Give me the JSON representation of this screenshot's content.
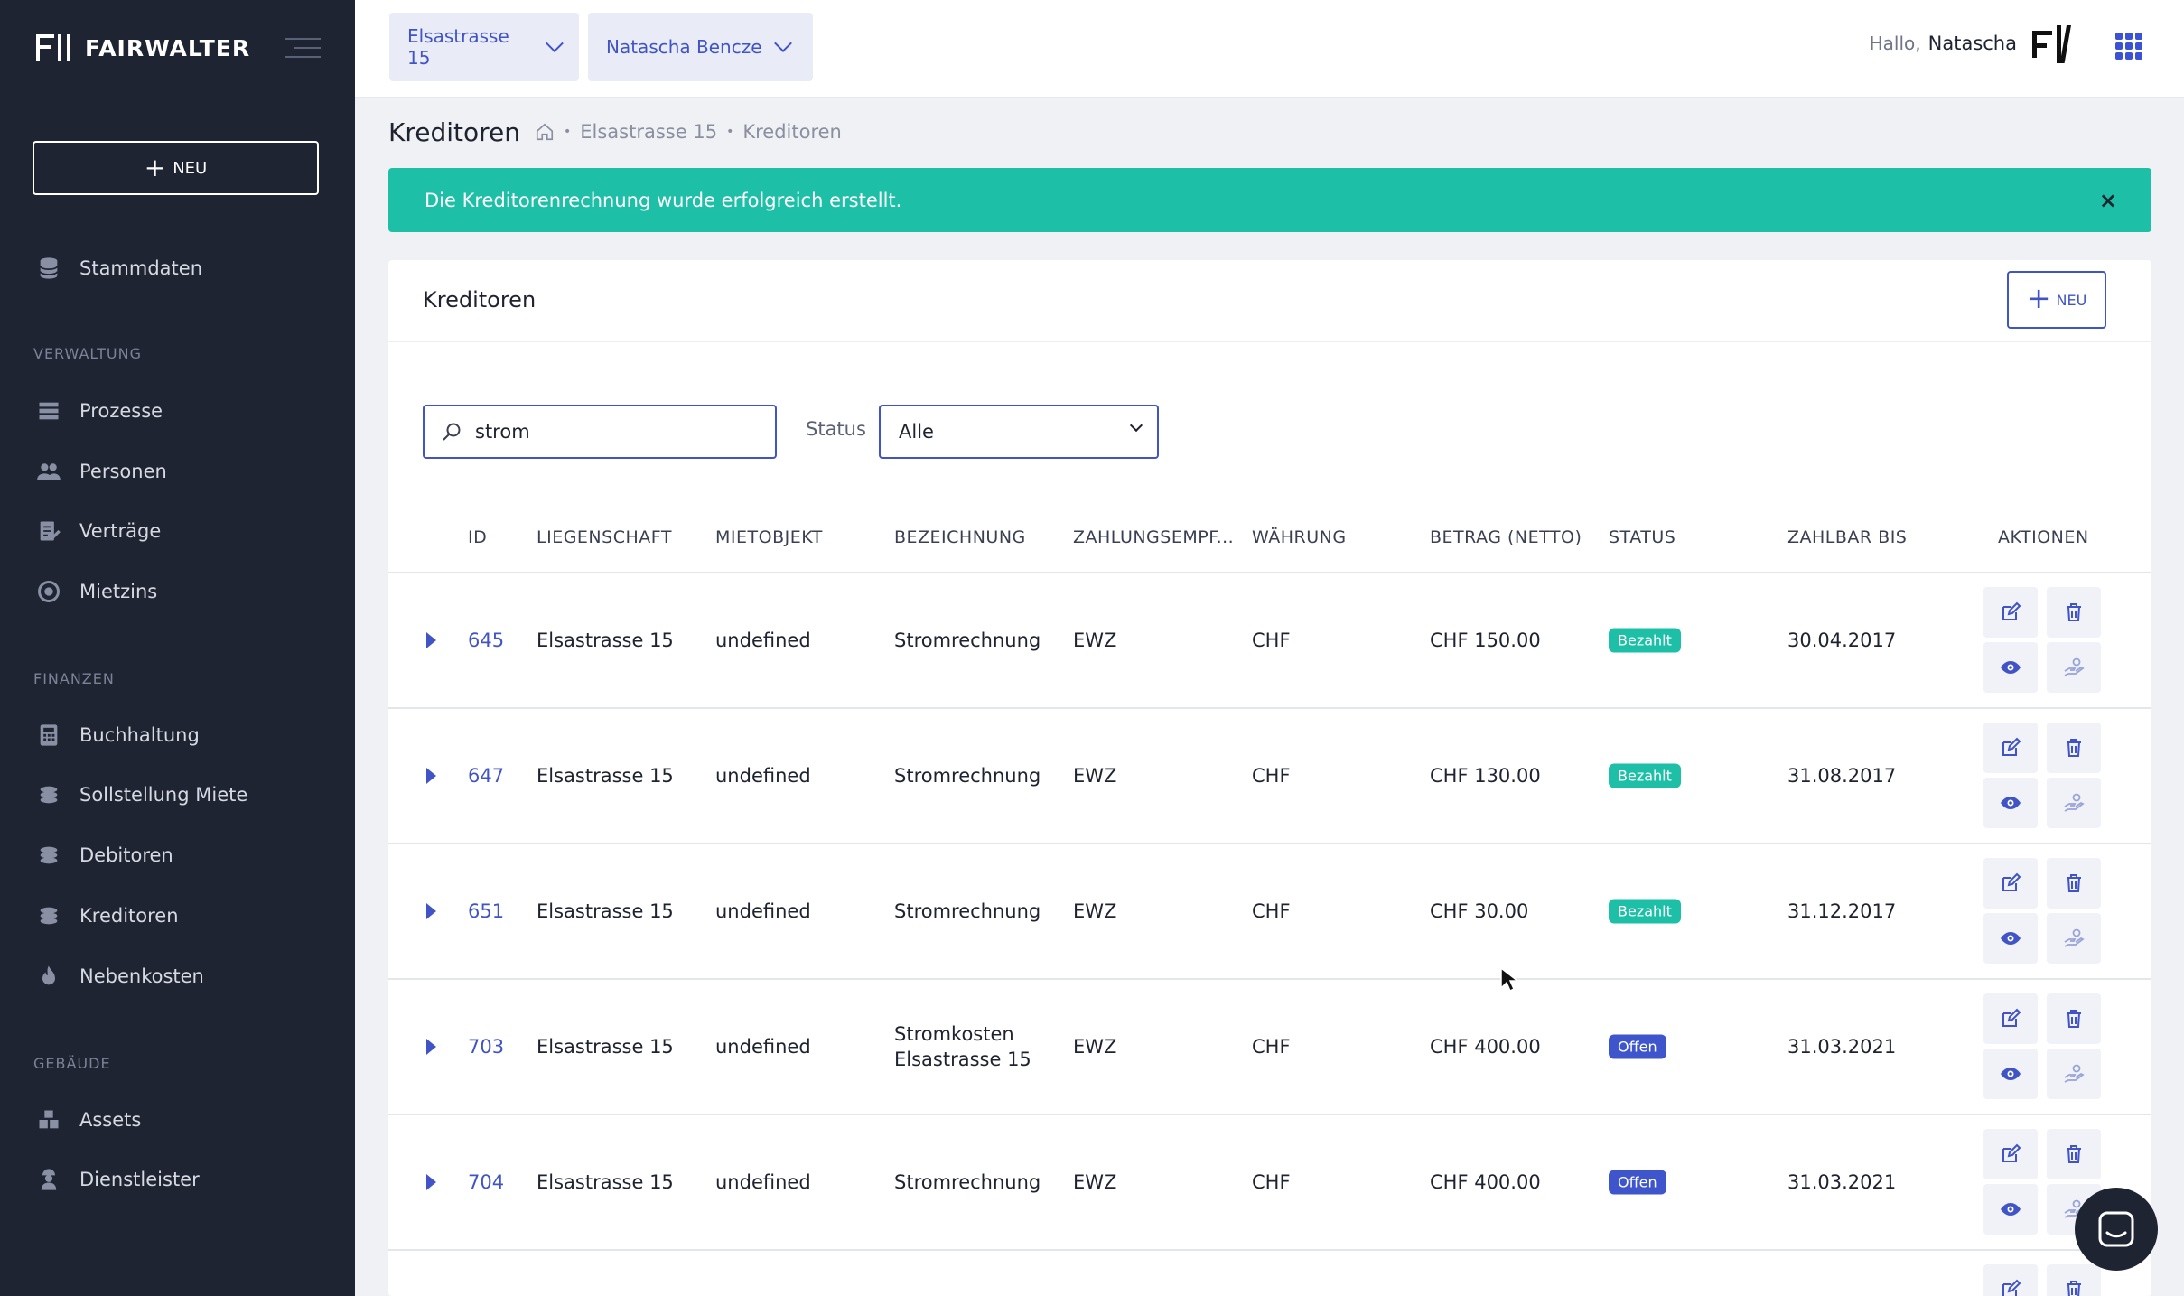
{
  "sidebar": {
    "brand": "FAIRWALTER",
    "new_label": "NEU",
    "items": [
      {
        "label": "Stammdaten",
        "icon": "database-icon"
      },
      {
        "label": "Prozesse",
        "icon": "list-icon"
      },
      {
        "label": "Personen",
        "icon": "people-icon"
      },
      {
        "label": "Verträge",
        "icon": "contract-icon"
      },
      {
        "label": "Mietzins",
        "icon": "rent-icon"
      },
      {
        "label": "Buchhaltung",
        "icon": "calculator-icon"
      },
      {
        "label": "Sollstellung Miete",
        "icon": "coins-icon"
      },
      {
        "label": "Debitoren",
        "icon": "coins-icon"
      },
      {
        "label": "Kreditoren",
        "icon": "coins-icon"
      },
      {
        "label": "Nebenkosten",
        "icon": "flame-icon"
      },
      {
        "label": "Assets",
        "icon": "boxes-icon"
      },
      {
        "label": "Dienstleister",
        "icon": "worker-icon"
      }
    ],
    "sections": {
      "verwaltung": "VERWALTUNG",
      "finanzen": "FINANZEN",
      "gebaeude": "GEBÄUDE"
    }
  },
  "topbar": {
    "property": "Elsastrasse 15",
    "person": "Natascha Bencze",
    "greeting": "Hallo,",
    "user": "Natascha"
  },
  "page": {
    "title": "Kreditoren",
    "breadcrumb": [
      "Elsastrasse 15",
      "Kreditoren"
    ]
  },
  "alert": {
    "message": "Die Kreditorenrechnung wurde erfolgreich erstellt.",
    "close": "×"
  },
  "card": {
    "title": "Kreditoren",
    "new_label": "NEU",
    "search_value": "strom",
    "status_label": "Status",
    "status_value": "Alle"
  },
  "table": {
    "headers": [
      "ID",
      "LIEGENSCHAFT",
      "MIETOBJEKT",
      "BEZEICHNUNG",
      "ZAHLUNGSEMPF...",
      "WÄHRUNG",
      "BETRAG (NETTO)",
      "STATUS",
      "ZAHLBAR BIS",
      "AKTIONEN"
    ],
    "rows": [
      {
        "id": "645",
        "property": "Elsastrasse 15",
        "object": "undefined",
        "desc": "Stromrechnung",
        "desc2": "",
        "payee": "EWZ",
        "currency": "CHF",
        "amount": "CHF 150.00",
        "status": "Bezahlt",
        "due": "30.04.2017"
      },
      {
        "id": "647",
        "property": "Elsastrasse 15",
        "object": "undefined",
        "desc": "Stromrechnung",
        "desc2": "",
        "payee": "EWZ",
        "currency": "CHF",
        "amount": "CHF 130.00",
        "status": "Bezahlt",
        "due": "31.08.2017"
      },
      {
        "id": "651",
        "property": "Elsastrasse 15",
        "object": "undefined",
        "desc": "Stromrechnung",
        "desc2": "",
        "payee": "EWZ",
        "currency": "CHF",
        "amount": "CHF 30.00",
        "status": "Bezahlt",
        "due": "31.12.2017"
      },
      {
        "id": "703",
        "property": "Elsastrasse 15",
        "object": "undefined",
        "desc": "Stromkosten",
        "desc2": "Elsastrasse 15",
        "payee": "EWZ",
        "currency": "CHF",
        "amount": "CHF 400.00",
        "status": "Offen",
        "due": "31.03.2021"
      },
      {
        "id": "704",
        "property": "Elsastrasse 15",
        "object": "undefined",
        "desc": "Stromrechnung",
        "desc2": "",
        "payee": "EWZ",
        "currency": "CHF",
        "amount": "CHF 400.00",
        "status": "Offen",
        "due": "31.03.2021"
      }
    ]
  },
  "colors": {
    "sidebar": "#1f2433",
    "accent": "#4054c6",
    "success": "#1ebfa7",
    "open": "#3f55cc"
  }
}
